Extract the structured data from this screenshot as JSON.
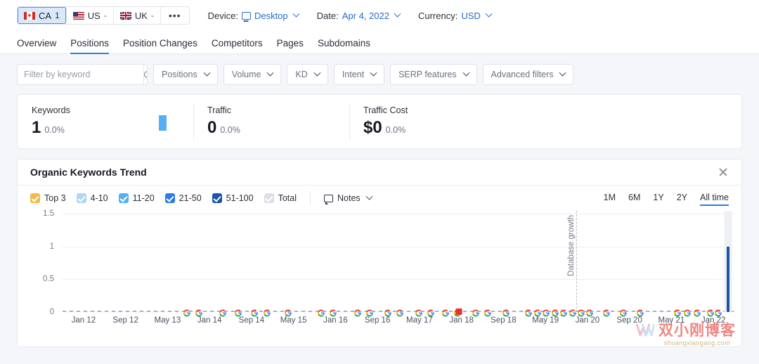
{
  "topbar": {
    "databases": [
      {
        "code": "CA",
        "count": "1",
        "flag": "flag-ca-icon",
        "active": true
      },
      {
        "code": "US",
        "count": "-",
        "flag": "flag-us-icon",
        "active": false
      },
      {
        "code": "UK",
        "count": "-",
        "flag": "flag-uk-icon",
        "active": false
      }
    ],
    "more_label": "•••",
    "device": {
      "label": "Device:",
      "value": "Desktop",
      "icon": "monitor-icon"
    },
    "date": {
      "label": "Date:",
      "value": "Apr 4, 2022"
    },
    "currency": {
      "label": "Currency:",
      "value": "USD"
    }
  },
  "nav": {
    "tabs": [
      {
        "label": "Overview",
        "active": false
      },
      {
        "label": "Positions",
        "active": true
      },
      {
        "label": "Position Changes",
        "active": false
      },
      {
        "label": "Competitors",
        "active": false
      },
      {
        "label": "Pages",
        "active": false
      },
      {
        "label": "Subdomains",
        "active": false
      }
    ]
  },
  "filters": {
    "search_placeholder": "Filter by keyword",
    "search_value": "",
    "search_icon": "search-icon",
    "buttons": [
      "Positions",
      "Volume",
      "KD",
      "Intent",
      "SERP features",
      "Advanced filters"
    ]
  },
  "metrics": [
    {
      "label": "Keywords",
      "value": "1",
      "change": "0.0%"
    },
    {
      "label": "Traffic",
      "value": "0",
      "change": "0.0%"
    },
    {
      "label": "Traffic Cost",
      "value": "$0",
      "change": "0.0%"
    }
  ],
  "chart_card": {
    "title": "Organic Keywords Trend",
    "close_icon": "close-icon",
    "legend": [
      {
        "label": "Top 3",
        "color": "#f5b945",
        "checked": true
      },
      {
        "label": "4-10",
        "color": "#aed6f7",
        "checked": true
      },
      {
        "label": "11-20",
        "color": "#56aef5",
        "checked": true
      },
      {
        "label": "21-50",
        "color": "#2f7ae5",
        "checked": true
      },
      {
        "label": "51-100",
        "color": "#1c54a8",
        "checked": true
      },
      {
        "label": "Total",
        "color": "#c9ced8",
        "checked": false
      }
    ],
    "notes_label": "Notes",
    "notes_icon": "note-bubble-icon",
    "periods": [
      {
        "label": "1M",
        "active": false
      },
      {
        "label": "6M",
        "active": false
      },
      {
        "label": "1Y",
        "active": false
      },
      {
        "label": "2Y",
        "active": false
      },
      {
        "label": "All time",
        "active": true
      }
    ]
  },
  "chart_data": {
    "type": "line",
    "title": "Organic Keywords Trend",
    "xlabel": "",
    "ylabel": "",
    "ylim": [
      0,
      1.5
    ],
    "yticks": [
      "0",
      "0.5",
      "1",
      "1.5"
    ],
    "ytick_values": [
      0,
      0.5,
      1,
      1.5
    ],
    "grid": true,
    "legend_position": "top-left",
    "xticks": [
      "Jan 12",
      "Sep 12",
      "May 13",
      "Jan 14",
      "Sep 14",
      "May 15",
      "Jan 16",
      "Sep 16",
      "May 17",
      "Jan 18",
      "Sep 18",
      "May 19",
      "Jan 20",
      "Sep 20",
      "May 21",
      "Jan 22"
    ],
    "series": [
      {
        "name": "Top 3",
        "color": "#f5b945",
        "x": [
          "Jan 12",
          "Sep 12",
          "May 13",
          "Jan 14",
          "Sep 14",
          "May 15",
          "Jan 16",
          "Sep 16",
          "May 17",
          "Jan 18",
          "Sep 18",
          "May 19",
          "Jan 20",
          "Sep 20",
          "May 21",
          "Jan 22"
        ],
        "values": [
          0,
          0,
          0,
          0,
          0,
          0,
          0,
          0,
          0,
          0,
          0,
          0,
          0,
          0,
          0,
          0
        ]
      },
      {
        "name": "4-10",
        "color": "#aed6f7",
        "values": [
          0,
          0,
          0,
          0,
          0,
          0,
          0,
          0,
          0,
          0,
          0,
          0,
          0,
          0,
          0,
          0
        ]
      },
      {
        "name": "11-20",
        "color": "#56aef5",
        "values": [
          0,
          0,
          0,
          0,
          0,
          0,
          0,
          0,
          0,
          0,
          0,
          0,
          0,
          0,
          0,
          0
        ]
      },
      {
        "name": "21-50",
        "color": "#2f7ae5",
        "values": [
          0,
          0,
          0,
          0,
          0,
          0,
          0,
          0,
          0,
          0,
          0,
          0,
          0,
          0,
          0,
          0
        ]
      },
      {
        "name": "51-100",
        "color": "#1c54a8",
        "values": [
          0,
          0,
          0,
          0,
          0,
          0,
          0,
          0,
          0,
          0,
          0,
          0,
          0,
          0,
          0,
          1
        ]
      }
    ],
    "annotations": [
      {
        "type": "vline",
        "label": "Database growth",
        "x_pct": 76.5
      },
      {
        "type": "marker",
        "label": "note",
        "color": "#e5342a",
        "x_pct": 59.0
      },
      {
        "type": "hover",
        "label": "current",
        "x_pct": 99.1
      }
    ],
    "algorithm_update_markers_icon": "google-g-icon",
    "google_marker_x_pcts": [
      18.5,
      20.3,
      23.8,
      26.2,
      28.6,
      30.4,
      33.6,
      38.5,
      40.3,
      43.9,
      45.7,
      48.4,
      50.2,
      53.0,
      54.8,
      57.0,
      58.8,
      61.5,
      63.3,
      66.0,
      69.4,
      70.7,
      72.0,
      73.3,
      74.6,
      75.9,
      77.2,
      78.5,
      81.0,
      83.5,
      86.0,
      91.5,
      93.0,
      94.5,
      96.4,
      97.6
    ]
  },
  "watermark": {
    "main": "双小刚博客",
    "sub": "shuangxiaogang.com"
  }
}
